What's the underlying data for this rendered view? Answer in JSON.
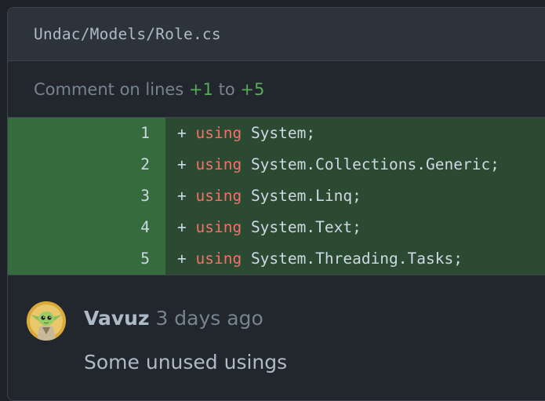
{
  "file": {
    "path": "Undac/Models/Role.cs"
  },
  "comment_range": {
    "prefix": "Comment on lines",
    "start": "+1",
    "middle": "to",
    "end": "+5"
  },
  "diff": {
    "marker": "+",
    "keyword": "using",
    "lines": [
      {
        "num": "1",
        "rest": " System;"
      },
      {
        "num": "2",
        "rest": " System.Collections.Generic;"
      },
      {
        "num": "3",
        "rest": " System.Linq;"
      },
      {
        "num": "4",
        "rest": " System.Text;"
      },
      {
        "num": "5",
        "rest": " System.Threading.Tasks;"
      }
    ]
  },
  "comment": {
    "author": "Vavuz",
    "time": "3 days ago",
    "body": "Some unused usings"
  },
  "colors": {
    "background": "#22272e",
    "header": "#2d333b",
    "addition_num": "#356b3d",
    "addition_code": "#2b4a31",
    "keyword": "#f47067",
    "add_text": "#57ab5a"
  }
}
